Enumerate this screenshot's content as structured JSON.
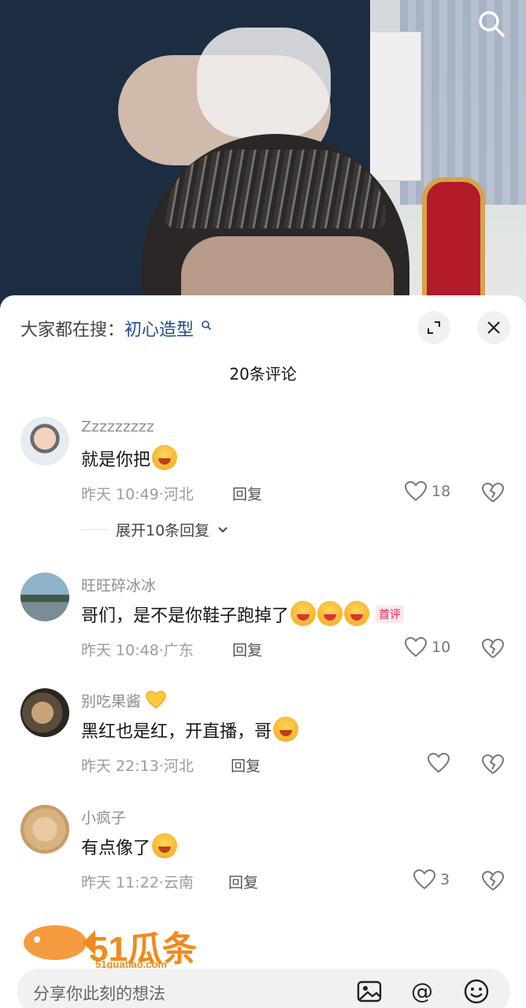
{
  "header": {
    "search_prefix": "大家都在搜：",
    "search_term": "初心造型",
    "comment_count": "20条评论"
  },
  "comments": [
    {
      "user": "Zzzzzzzzz",
      "text": "就是你把",
      "time": "昨天 10:49",
      "location": "河北",
      "reply_label": "回复",
      "likes": "18",
      "expand_label": "展开10条回复"
    },
    {
      "user": "旺旺碎冰冰",
      "text": "哥们，是不是你鞋子跑掉了",
      "badge": "首评",
      "time": "昨天 10:48",
      "location": "广东",
      "reply_label": "回复",
      "likes": "10"
    },
    {
      "user": "别吃果酱",
      "text": "黑红也是红，开直播，哥",
      "time": "昨天 22:13",
      "location": "河北",
      "reply_label": "回复",
      "likes": ""
    },
    {
      "user": "小疯子",
      "text": "有点像了",
      "time": "昨天 11:22",
      "location": "云南",
      "reply_label": "回复",
      "likes": "3"
    }
  ],
  "watermark": {
    "brand": "51瓜条",
    "url": "51guatiao.com"
  },
  "input": {
    "placeholder": "分享你此刻的想法"
  },
  "colors": {
    "accent_link": "#1f4c8f",
    "badge": "#e0284f",
    "watermark": "#f28a1d"
  }
}
